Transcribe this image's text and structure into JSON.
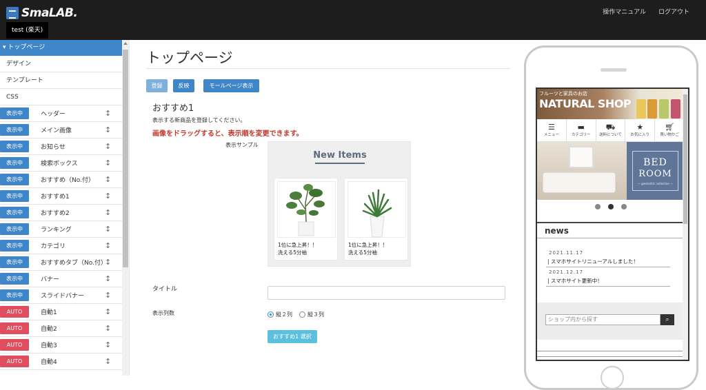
{
  "app": {
    "logo": "SmaLAB.",
    "tenant": "test (楽天)"
  },
  "header_links": {
    "manual": "操作マニュアル",
    "logout": "ログアウト"
  },
  "sidebar": {
    "header": "トップページ",
    "plain": [
      "デザイン",
      "テンプレート",
      "CSS"
    ],
    "rows": [
      {
        "badge": "表示中",
        "label": "ヘッダー",
        "color": "#3f86c9"
      },
      {
        "badge": "表示中",
        "label": "メイン画像",
        "color": "#3f86c9"
      },
      {
        "badge": "表示中",
        "label": "お知らせ",
        "color": "#3f86c9"
      },
      {
        "badge": "表示中",
        "label": "検索ボックス",
        "color": "#3f86c9"
      },
      {
        "badge": "表示中",
        "label": "おすすめ（No.付）",
        "color": "#3f86c9"
      },
      {
        "badge": "表示中",
        "label": "おすすめ1",
        "color": "#3f86c9"
      },
      {
        "badge": "表示中",
        "label": "おすすめ2",
        "color": "#3f86c9"
      },
      {
        "badge": "表示中",
        "label": "ランキング",
        "color": "#3f86c9"
      },
      {
        "badge": "表示中",
        "label": "カテゴリ",
        "color": "#3f86c9"
      },
      {
        "badge": "表示中",
        "label": "おすすめタブ（No.付）",
        "color": "#3f86c9"
      },
      {
        "badge": "表示中",
        "label": "バナー",
        "color": "#3f86c9"
      },
      {
        "badge": "表示中",
        "label": "スライドバナー",
        "color": "#3f86c9"
      },
      {
        "badge": "AUTO",
        "label": "自動1",
        "color": "#df4d5f"
      },
      {
        "badge": "AUTO",
        "label": "自動2",
        "color": "#df4d5f"
      },
      {
        "badge": "AUTO",
        "label": "自動3",
        "color": "#df4d5f"
      },
      {
        "badge": "AUTO",
        "label": "自動4",
        "color": "#df4d5f"
      }
    ]
  },
  "main": {
    "title": "トップページ",
    "buttons": {
      "register": "登録",
      "apply": "反映",
      "mall": "モールページ表示"
    },
    "section_title": "おすすめ1",
    "description": "表示する新商品を登録してください。",
    "warning": "画像をドラッグすると、表示順を変更できます。",
    "sample_label": "表示サンプル",
    "sample": {
      "heading": "New Items",
      "cards": [
        {
          "line1": "1位に急上昇！！",
          "line2": "洗える5分袖"
        },
        {
          "line1": "1位に急上昇！！",
          "line2": "洗える5分袖"
        }
      ]
    },
    "title_label": "タイトル",
    "title_value": "",
    "columns_label": "表示列数",
    "columns_options": [
      "縦２列",
      "縦３列"
    ],
    "columns_selected": "縦２列",
    "select_button": "おすすめ1 選択"
  },
  "phone": {
    "banner_sub": "フルーツと家具のお店",
    "banner_title": "NATURAL SHOP",
    "nav": [
      "メニュー",
      "カテゴリー",
      "送料について",
      "お気に入り",
      "買い物かご"
    ],
    "hero_line1": "BED",
    "hero_line2": "ROOM",
    "hero_caption": "— geometric collection —",
    "news_heading": "news",
    "news": [
      {
        "date": "2021.11.17",
        "text": "スマホサイトリニューアルしました！"
      },
      {
        "date": "2021.12.17",
        "text": "スマホサイト更新中！"
      }
    ],
    "search_placeholder": "ショップ内から探す"
  },
  "colors": {
    "accent": "#3f86c9",
    "auto_badge": "#df4d5f",
    "warning": "#c0392b",
    "select_button": "#5bc0de"
  }
}
